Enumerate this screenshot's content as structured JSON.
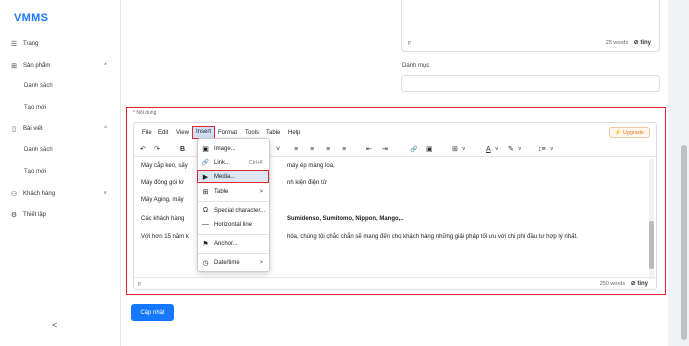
{
  "app": {
    "logo": "VMMS",
    "collapse_glyph": "<"
  },
  "sidebar": {
    "items": [
      {
        "label": "Trang",
        "icon": "menu-icon",
        "glyph": "☰"
      },
      {
        "label": "Sản phẩm",
        "icon": "grid-icon",
        "glyph": "⊞",
        "chevron": "^"
      },
      {
        "label": "Danh sách",
        "sub": true
      },
      {
        "label": "Tạo mới",
        "sub": true
      },
      {
        "label": "Bài viết",
        "icon": "document-icon",
        "glyph": "▯",
        "chevron": "^"
      },
      {
        "label": "Danh sách",
        "sub": true
      },
      {
        "label": "Tạo mới",
        "sub": true
      },
      {
        "label": "Khách hàng",
        "icon": "user-icon",
        "glyph": "⚇",
        "chevron": "˅"
      },
      {
        "label": "Thiết lập",
        "icon": "gear-icon",
        "glyph": "⚙"
      }
    ]
  },
  "top_editor": {
    "path": "p",
    "word_count": "25 words",
    "brand": "tiny"
  },
  "danh_muc": {
    "label": "Danh mục",
    "value": ""
  },
  "noi_dung": {
    "required_mark": "*",
    "label": "Nội dung"
  },
  "editor": {
    "menu": [
      "File",
      "Edit",
      "View",
      "Insert",
      "Format",
      "Tools",
      "Table",
      "Help"
    ],
    "active_menu": "Insert",
    "upgrade_label": "Upgrade",
    "toolbar": {
      "undo": "↶",
      "redo": "↷",
      "bold": "B",
      "dropdown_chevron": "˅",
      "align_left": "≡",
      "align_center": "≡",
      "align_right": "≡",
      "align_justify": "≡",
      "outdent": "⇤",
      "indent": "⇥",
      "link": "🔗",
      "image": "▣",
      "table": "⊞",
      "text_color": "A",
      "highlight": "✎",
      "line_height": "↕≡"
    },
    "content": {
      "line1_start": "Máy cắp keo, sấy",
      "line1_end": "máy ép màng loa,",
      "line2_start": "Máy đóng gói lơ",
      "line2_end": "nh kiện điện tử",
      "line3_start": "Máy Aging, máy",
      "line4_start": "Các khách hàng",
      "line4_bold": "Sumidenso, Sumitomo, Nippon, Mango,..",
      "line5_start": "Với hơn 15 năm k",
      "line5_end": "hóa, chúng tôi chắc chắn sẽ mang đến cho khách hàng những giải pháp tối ưu với chi phí đầu tư hợp lý nhất."
    },
    "status": {
      "path": "p",
      "word_count": "250 words",
      "brand": "tiny"
    }
  },
  "insert_menu": {
    "items": [
      {
        "label": "Image...",
        "icon": "image-icon",
        "glyph": "▣"
      },
      {
        "label": "Link...",
        "icon": "link-icon",
        "glyph": "🔗",
        "shortcut": "Ctrl+K"
      },
      {
        "label": "Media...",
        "icon": "media-icon",
        "glyph": "▶"
      },
      {
        "label": "Table",
        "icon": "table-icon",
        "glyph": "⊞",
        "has_submenu": true
      },
      {
        "label": "Special character...",
        "icon": "omega-icon",
        "glyph": "Ω"
      },
      {
        "label": "Horizontal line",
        "icon": "horizontal-line-icon",
        "glyph": "—"
      },
      {
        "label": "Anchor...",
        "icon": "bookmark-icon",
        "glyph": "⚑"
      },
      {
        "label": "Date/time",
        "icon": "clock-icon",
        "glyph": "◷",
        "has_submenu": true
      }
    ],
    "highlighted": "Media...",
    "submenu_arrow": ">"
  },
  "actions": {
    "update_label": "Cập nhật"
  },
  "colors": {
    "accent": "#1677ff",
    "highlight_border": "#e0262d",
    "upgrade": "#e07b27"
  }
}
